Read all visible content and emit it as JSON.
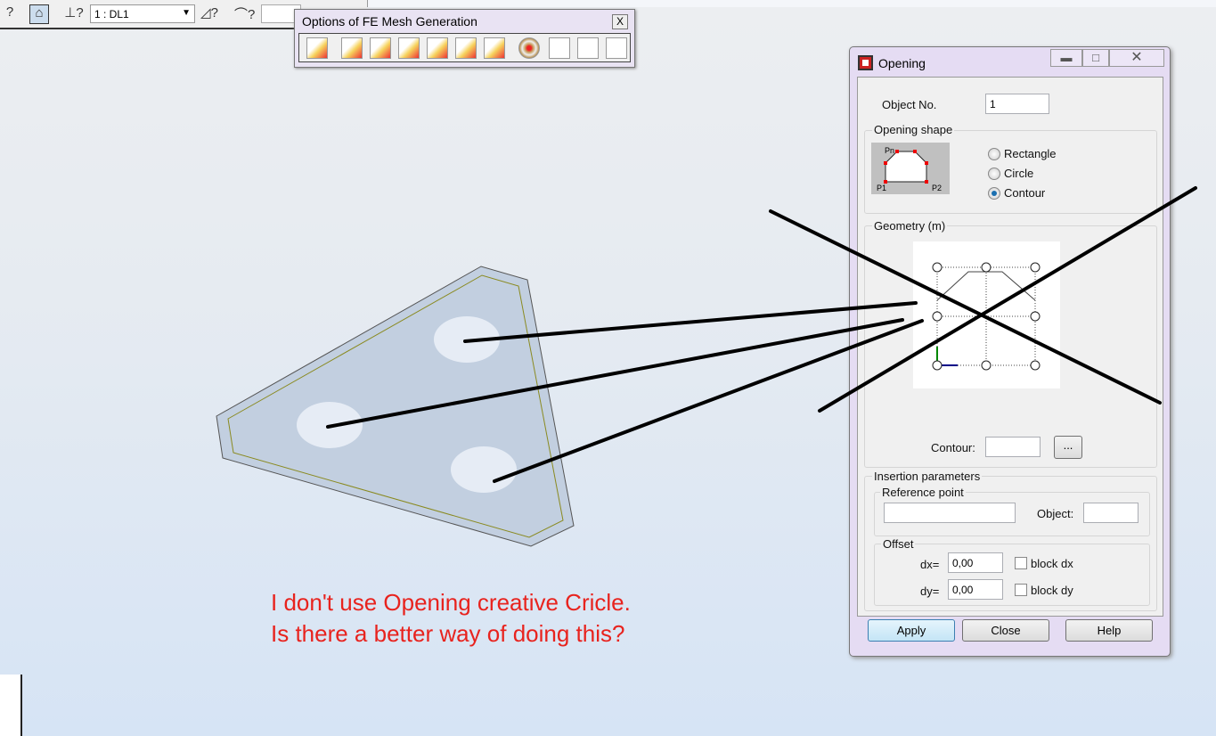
{
  "toolbar": {
    "load_case": "1 : DL1",
    "icons": [
      "help-cursor-icon",
      "view-icon",
      "support-help-icon",
      "load-help-icon",
      "member-help-icon"
    ]
  },
  "fe_toolbar": {
    "title": "Options of FE Mesh Generation",
    "close": "X",
    "icons": [
      "generate-mesh-icon",
      "mesh-color-icon",
      "mesh-grid-icon",
      "lock-mesh-icon",
      "unlock-mesh-icon",
      "refine-mesh-icon",
      "delete-mesh-icon",
      "target-icon",
      "grid-select-1-icon",
      "grid-select-2-icon",
      "grid-select-3-icon"
    ]
  },
  "dialog": {
    "title": "Opening",
    "object_no_label": "Object No.",
    "object_no": "1",
    "shape_group": "Opening shape",
    "shape_preview": {
      "pn": "Pn",
      "p1": "P1",
      "p2": "P2"
    },
    "shapes": [
      {
        "label": "Rectangle",
        "selected": false
      },
      {
        "label": "Circle",
        "selected": false
      },
      {
        "label": "Contour",
        "selected": true
      }
    ],
    "geometry_group": "Geometry (m)",
    "contour_label": "Contour:",
    "contour_value": "",
    "contour_button": "...",
    "insertion_group": "Insertion parameters",
    "reference_group": "Reference point",
    "reference_value": "",
    "object_label": "Object:",
    "object_value": "",
    "offset_group": "Offset",
    "dx_label": "dx=",
    "dx": "0,00",
    "block_dx": "block dx",
    "dy_label": "dy=",
    "dy": "0,00",
    "block_dy": "block dy",
    "buttons": {
      "apply": "Apply",
      "close": "Close",
      "help": "Help"
    }
  },
  "annotation": {
    "line1": "I don't use Opening creative Cricle.",
    "line2": "Is there a better way of doing this?",
    "color": "#e8231e"
  }
}
